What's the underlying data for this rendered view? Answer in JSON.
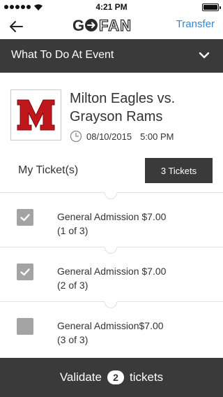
{
  "status": {
    "time": "4:21 PM",
    "battery_icon": "battery-icon",
    "signal_icon": "signal-dots-icon",
    "wifi_icon": "wifi-icon"
  },
  "nav": {
    "back_icon": "arrow-left-icon",
    "logo_text": "GOFAN",
    "transfer_label": "Transfer",
    "accent": "#3a86c8"
  },
  "section": {
    "title": "What To Do At Event",
    "toggle_icon": "chevron-down-icon"
  },
  "event": {
    "logo_letter": "M",
    "logo_color": "#c0171c",
    "title": "Milton Eagles vs. Grayson Rams",
    "clock_icon": "clock-icon",
    "date": "08/10/2015",
    "time": "5:00 PM"
  },
  "tickets": {
    "label": "My Ticket(s)",
    "count_label": "3 Tickets",
    "items": [
      {
        "line1": "General Admission $7.00",
        "line2": "(1 of 3)",
        "checked": true
      },
      {
        "line1": "General Admission $7.00",
        "line2": "(2 of 3)",
        "checked": true
      },
      {
        "line1": "General Admission$7.00",
        "line2": "(3 of 3)",
        "checked": false
      }
    ]
  },
  "footer": {
    "prefix": "Validate",
    "count": "2",
    "suffix": "tickets"
  }
}
